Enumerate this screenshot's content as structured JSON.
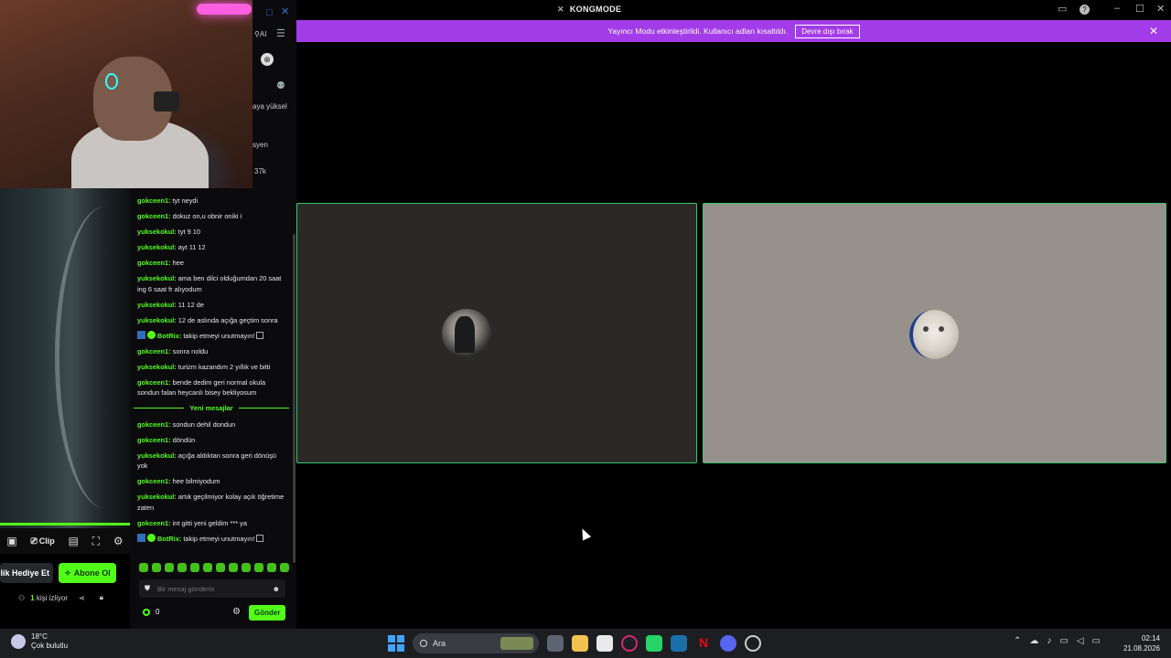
{
  "window": {
    "title": "KONGMODE"
  },
  "banner": {
    "text": "Yayıncı Modu etkinleştirildi. Kullanıcı adları kısaltıldı.",
    "button": "Devre dışı bırak"
  },
  "sidebar_strip": {
    "ai_label": "AI",
    "line1": "aya yüksel",
    "line2": "syen",
    "line3": "37k"
  },
  "player": {
    "clip_label": "Clip"
  },
  "actions": {
    "gift_label": "ellik Hediye Et",
    "subscribe_label": "Abone Ol"
  },
  "viewers": {
    "count": "1",
    "label": "kişi izliyor"
  },
  "chat": {
    "messages_before": [
      {
        "user": "gokceen1",
        "text": "tyt neydi"
      },
      {
        "user": "gokceen1",
        "text": "dokuz on,u obnir oniki i"
      },
      {
        "user": "yuksekokul",
        "text": "tyt 9 10"
      },
      {
        "user": "yuksekokul",
        "text": "ayt 11 12"
      },
      {
        "user": "gokceen1",
        "text": "hee"
      },
      {
        "user": "yuksekokul",
        "text": "ama ben dilci olduğumdan 20 saat ing 6 saat fr alıyodum"
      },
      {
        "user": "yuksekokul",
        "text": "11 12 de"
      },
      {
        "user": "yuksekokul",
        "text": "12 de aslında açığa geçtim sonra"
      },
      {
        "user": "BotRix",
        "text": "takip etmeyi unutmayın!",
        "bot": true
      },
      {
        "user": "gokceen1",
        "text": "sonra noldu"
      },
      {
        "user": "yuksekokul",
        "text": "turizm kazandım 2 yıllık ve bitti"
      },
      {
        "user": "gokceen1",
        "text": "bende dedim geri normal okula sondun falan heycanlı bisey bekliyosum"
      }
    ],
    "new_messages_label": "Yeni mesajlar",
    "messages_after": [
      {
        "user": "gokceen1",
        "text": "sondun dehil dondun"
      },
      {
        "user": "gokceen1",
        "text": "döndün"
      },
      {
        "user": "yuksekokul",
        "text": "açığa aldıktan sonra geri dönüşü yok"
      },
      {
        "user": "gokceen1",
        "text": "hee bilmiyodum"
      },
      {
        "user": "yuksekokul",
        "text": "artık geçilmiyor kolay açık öğretime zaten"
      },
      {
        "user": "gokceen1",
        "text": "int gitti yeni geldim *** ya"
      },
      {
        "user": "BotRix",
        "text": "takip etmeyi unutmayın!",
        "bot": true
      }
    ],
    "input_placeholder": "Bir mesaj gönderin",
    "points": "0",
    "send_label": "Gönder"
  },
  "taskbar": {
    "weather_temp": "18°C",
    "weather_desc": "Çok bulutlu",
    "search_label": "Ara",
    "time": "02:14",
    "date": "21.08.2026"
  },
  "colors": {
    "accent_green": "#53fc18",
    "banner_purple": "#a23be8",
    "tile_border": "#38c96e"
  }
}
